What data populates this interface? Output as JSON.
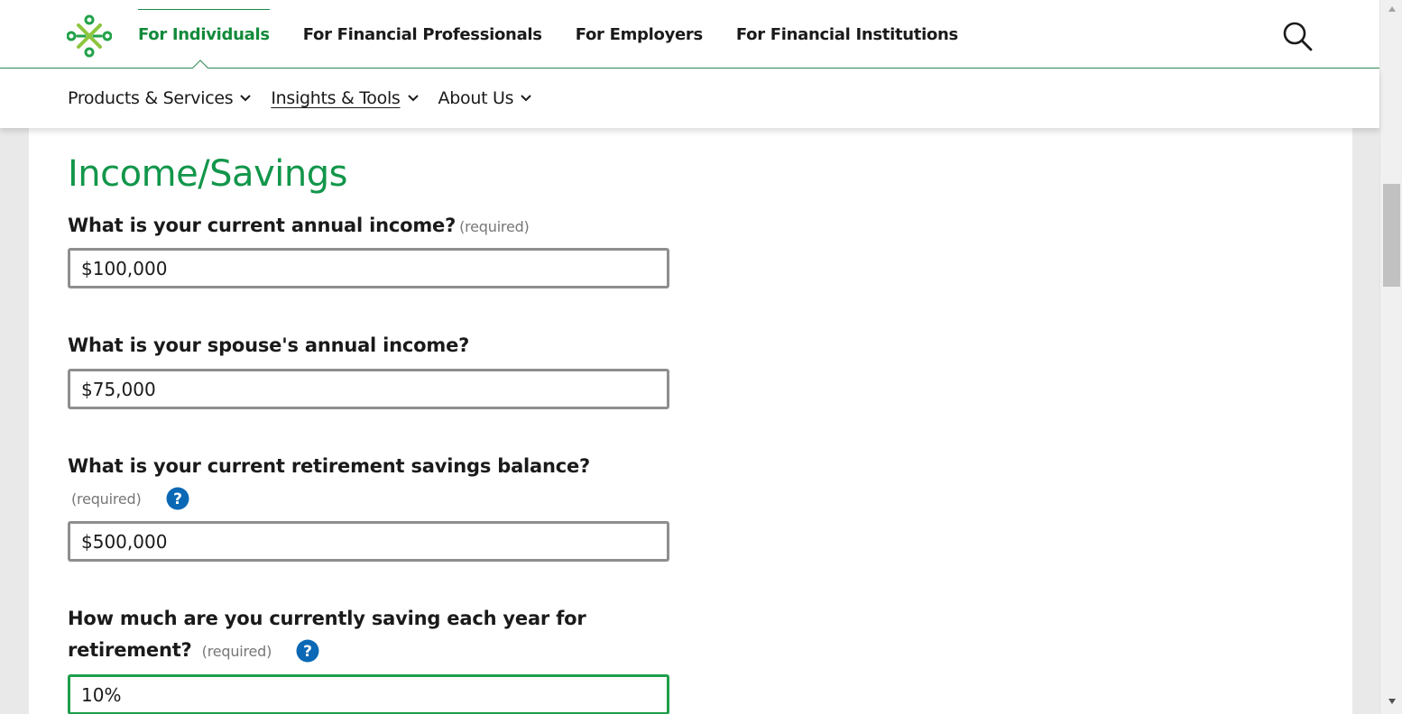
{
  "header": {
    "audience_nav": [
      {
        "label": "For Individuals",
        "active": true
      },
      {
        "label": "For Financial Professionals",
        "active": false
      },
      {
        "label": "For Employers",
        "active": false
      },
      {
        "label": "For Financial Institutions",
        "active": false
      }
    ],
    "search_icon": "search-icon"
  },
  "sub_nav": [
    {
      "label": "Products & Services"
    },
    {
      "label": "Insights & Tools"
    },
    {
      "label": "About Us"
    }
  ],
  "form": {
    "section_title": "Income/Savings",
    "questions": [
      {
        "label": "What is your current annual income?",
        "required": "(required)",
        "value": "$100,000",
        "help": false
      },
      {
        "label": "What is your spouse's annual income?",
        "required": "",
        "value": "$75,000",
        "help": false
      },
      {
        "label": "What is your current retirement savings balance?",
        "required": "(required)",
        "value": "$500,000",
        "help": true
      },
      {
        "label": "How much are you currently saving each year for retirement?",
        "required": "(required)",
        "value": "10%",
        "help": true
      }
    ]
  },
  "colors": {
    "brand_green": "#12964a",
    "active_green": "#128a3a",
    "help_blue": "#0b68b5",
    "focus_green": "#1e9e4c"
  }
}
